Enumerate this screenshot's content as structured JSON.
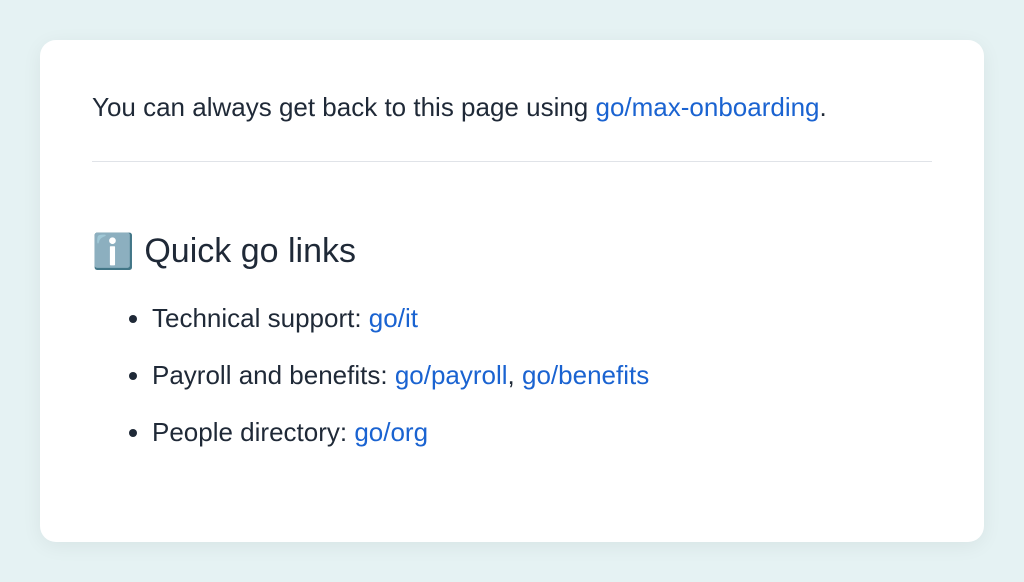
{
  "intro": {
    "prefix": "You can always get back to this page using ",
    "link_text": "go/max-onboarding",
    "suffix": "."
  },
  "heading": {
    "icon": "ℹ️",
    "text": "Quick go links"
  },
  "items": [
    {
      "label": "Technical support: ",
      "links": [
        {
          "text": "go/it"
        }
      ]
    },
    {
      "label": "Payroll and benefits: ",
      "links": [
        {
          "text": "go/payroll"
        },
        {
          "text": "go/benefits"
        }
      ]
    },
    {
      "label": "People directory: ",
      "links": [
        {
          "text": "go/org"
        }
      ]
    }
  ],
  "separator": ", "
}
